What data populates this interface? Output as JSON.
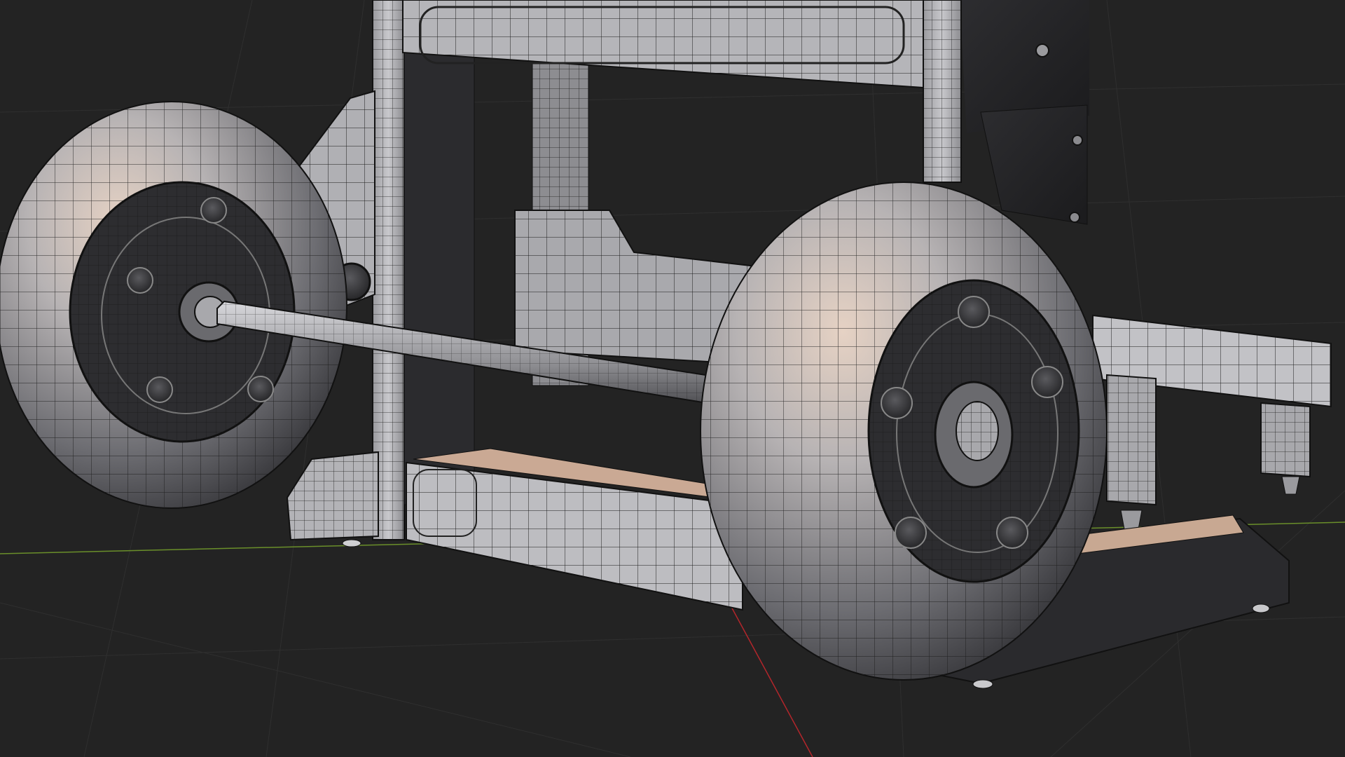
{
  "viewport": {
    "name": "3d-viewport",
    "background_color": "#232323",
    "grid_color": "#2f2f2f",
    "x_axis_color": "#b3262b",
    "y_axis_color": "#6a8f2a",
    "mode": "wireframe-overlay"
  },
  "scene": {
    "object": "hand-truck-model",
    "material_color": "#b9b9bd",
    "wire_color": "#1a1a1a",
    "highlight_color": "#d8b59b",
    "shadow_color": "#3a3a3c"
  }
}
